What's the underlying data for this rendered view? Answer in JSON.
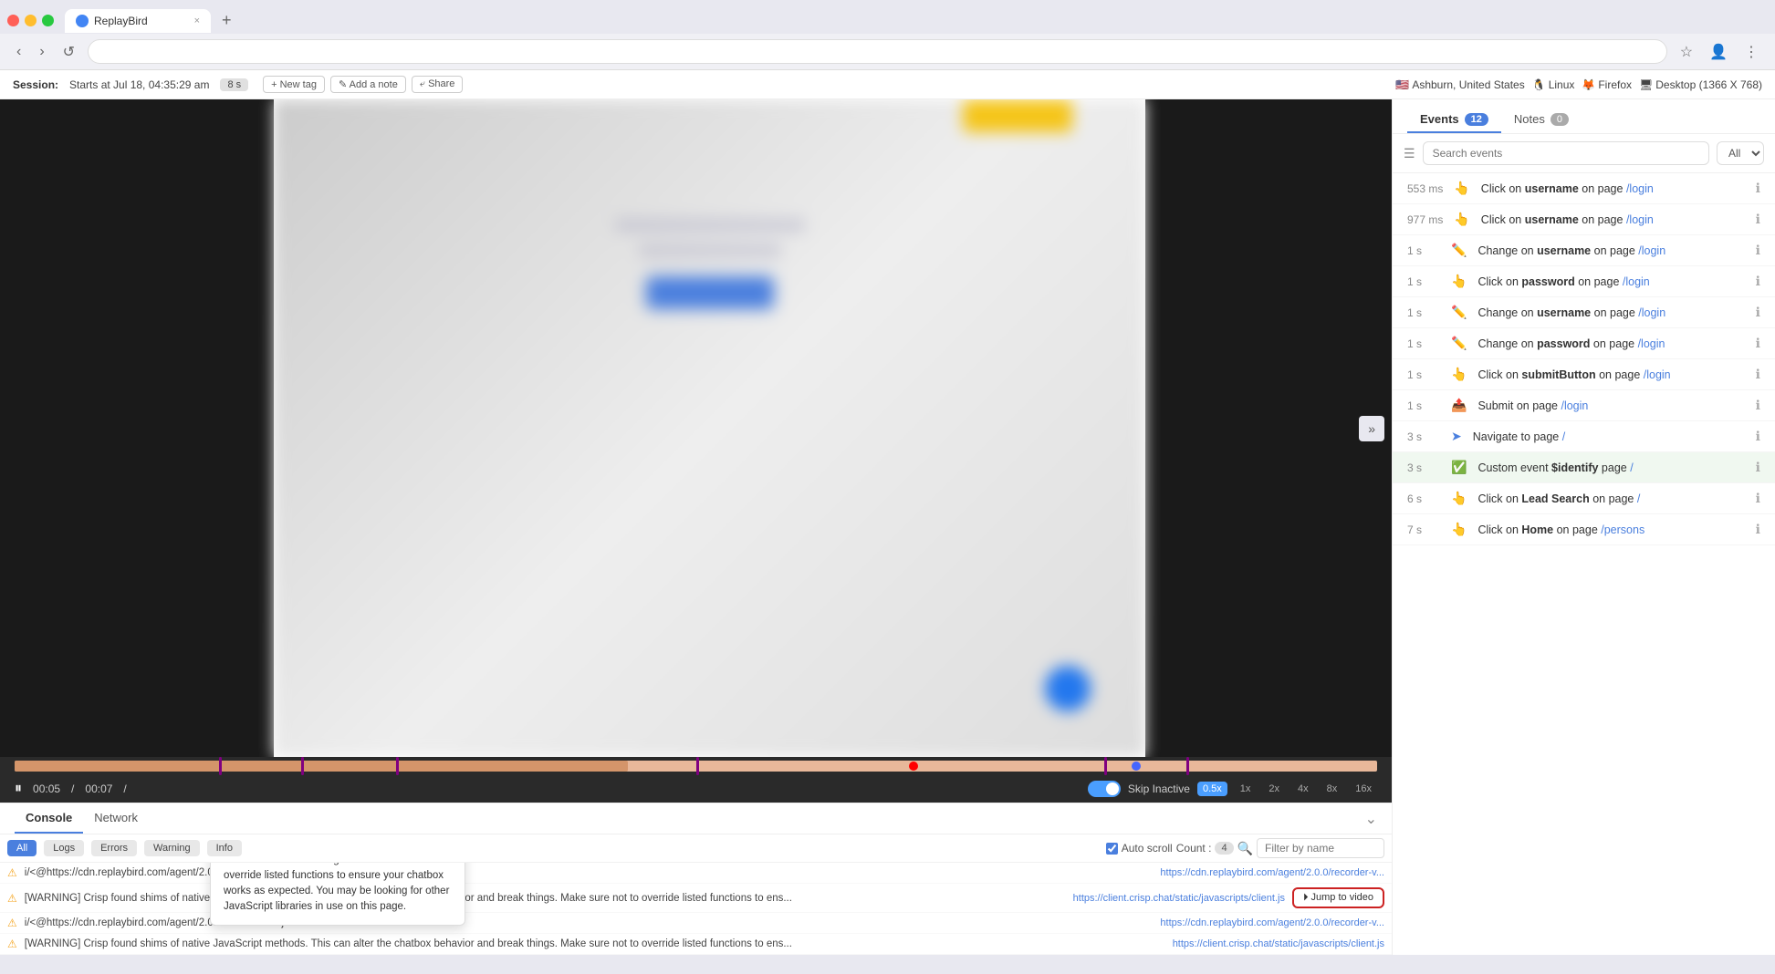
{
  "browser": {
    "tab_title": "ReplayBird",
    "tab_close": "×",
    "tab_new": "+",
    "url": "",
    "back": "‹",
    "forward": "›",
    "refresh": "↺",
    "bookmark": "☆",
    "account": "👤",
    "menu": "⋮"
  },
  "session": {
    "label": "Session:",
    "info": "Starts at Jul 18, 04:35:29 am",
    "duration": "8 s",
    "new_tag": "+ New tag",
    "add_note": "✎ Add a note",
    "share": "⤶ Share",
    "env_country": "🇺🇸",
    "env_location": "Ashburn, United States",
    "env_os_icon": "🐧",
    "env_os": "Linux",
    "env_browser_icon": "🦊",
    "env_browser": "Firefox",
    "env_screen_icon": "🖥",
    "env_screen": "Desktop (1366 X 768)"
  },
  "video": {
    "timeline_progress_pct": 45,
    "time_current": "00:05",
    "time_total": "00:07",
    "separator": "/"
  },
  "controls": {
    "play_icon": "⏸",
    "skip_inactive": "Skip Inactive",
    "speeds": [
      "0.5x",
      "1x",
      "2x",
      "4x",
      "8x",
      "16x"
    ],
    "active_speed": "0.5x"
  },
  "console": {
    "tab_console": "Console",
    "tab_network": "Network",
    "collapse_icon": "⌄",
    "filter_all": "All",
    "filter_logs": "Logs",
    "filter_errors": "Errors",
    "filter_warning": "Warning",
    "filter_info": "Info",
    "autoscroll": "Auto scroll",
    "count_label": "Count :",
    "count": "4",
    "filter_placeholder": "Filter by name",
    "rows": [
      {
        "icon": "⚠",
        "text": "i/<@https://cdn.replaybird.com/agent/2.0.0...",
        "url": "https://cdn.replaybird.com/agent/2.0.0/recorder-v..."
      },
      {
        "icon": "⚠",
        "text": "[WARNING] Crisp found shims of native JavaScript methods. This can alter the chatbox behavior and break things. Make sure not to override listed functions to ens...",
        "url": "https://client.crisp.chat/static/javascripts/client.js",
        "has_jump": true
      },
      {
        "icon": "⚠",
        "text": "i/<@https://cdn.replaybird.com/agent/2.0.0/recorder-v2.js?v=2.0.0:16:23270",
        "url": "https://cdn.replaybird.com/agent/2.0.0/recorder-v..."
      },
      {
        "icon": "⚠",
        "text": "[WARNING] Crisp found shims of native JavaScript methods. This can alter the chatbox behavior and break things. Make sure not to override listed functions to ens...",
        "url": "https://client.crisp.chat/static/javascripts/client.js"
      }
    ],
    "jump_btn": "⏵ Jump to video",
    "tooltip": {
      "text": "[WARNING] Crisp found shims of native JavaScript methods. This can alter the chatbox behavior and break things. Make sure not to override listed functions to ensure your chatbox works as expected. You may be looking for other JavaScript libraries in use on this page."
    }
  },
  "events_panel": {
    "toggle_icon": "»",
    "tab_events": "Events",
    "events_count": "12",
    "tab_notes": "Notes",
    "notes_count": "0",
    "search_placeholder": "Search events",
    "filter_all": "All",
    "events": [
      {
        "time": "553 ms",
        "icon": "👆",
        "icon_type": "click",
        "text_pre": "Click on ",
        "bold": "username",
        "text_mid": " on page ",
        "page": "/login"
      },
      {
        "time": "977 ms",
        "icon": "👆",
        "icon_type": "click",
        "text_pre": "Click on ",
        "bold": "username",
        "text_mid": " on page ",
        "page": "/login"
      },
      {
        "time": "1 s",
        "icon": "✏",
        "icon_type": "change",
        "text_pre": "Change on ",
        "bold": "username",
        "text_mid": " on page ",
        "page": "/login"
      },
      {
        "time": "1 s",
        "icon": "👆",
        "icon_type": "click",
        "text_pre": "Click on ",
        "bold": "password",
        "text_mid": " on page ",
        "page": "/login"
      },
      {
        "time": "1 s",
        "icon": "✏",
        "icon_type": "change",
        "text_pre": "Change on ",
        "bold": "username",
        "text_mid": " on page ",
        "page": "/login"
      },
      {
        "time": "1 s",
        "icon": "✏",
        "icon_type": "change",
        "text_pre": "Change on ",
        "bold": "password",
        "text_mid": " on page ",
        "page": "/login"
      },
      {
        "time": "1 s",
        "icon": "👆",
        "icon_type": "click",
        "text_pre": "Click on ",
        "bold": "submitButton",
        "text_mid": " on page ",
        "page": "/login"
      },
      {
        "time": "1 s",
        "icon": "📤",
        "icon_type": "submit",
        "text_pre": "Submit on page ",
        "bold": "",
        "text_mid": "",
        "page": "/login"
      },
      {
        "time": "3 s",
        "icon": "➤",
        "icon_type": "navigate",
        "text_pre": "Navigate to page ",
        "bold": "",
        "text_mid": "",
        "page": "/"
      },
      {
        "time": "3 s",
        "icon": "✅",
        "icon_type": "custom",
        "text_pre": "Custom event ",
        "bold": "$identify",
        "text_mid": " page ",
        "page": "/",
        "highlighted": true
      },
      {
        "time": "6 s",
        "icon": "👆",
        "icon_type": "click",
        "text_pre": "Click on ",
        "bold": "Lead Search",
        "text_mid": " on page ",
        "page": "/"
      },
      {
        "time": "7 s",
        "icon": "👆",
        "icon_type": "click",
        "text_pre": "Click on ",
        "bold": "Home",
        "text_mid": " on page ",
        "page": "/persons"
      }
    ]
  }
}
